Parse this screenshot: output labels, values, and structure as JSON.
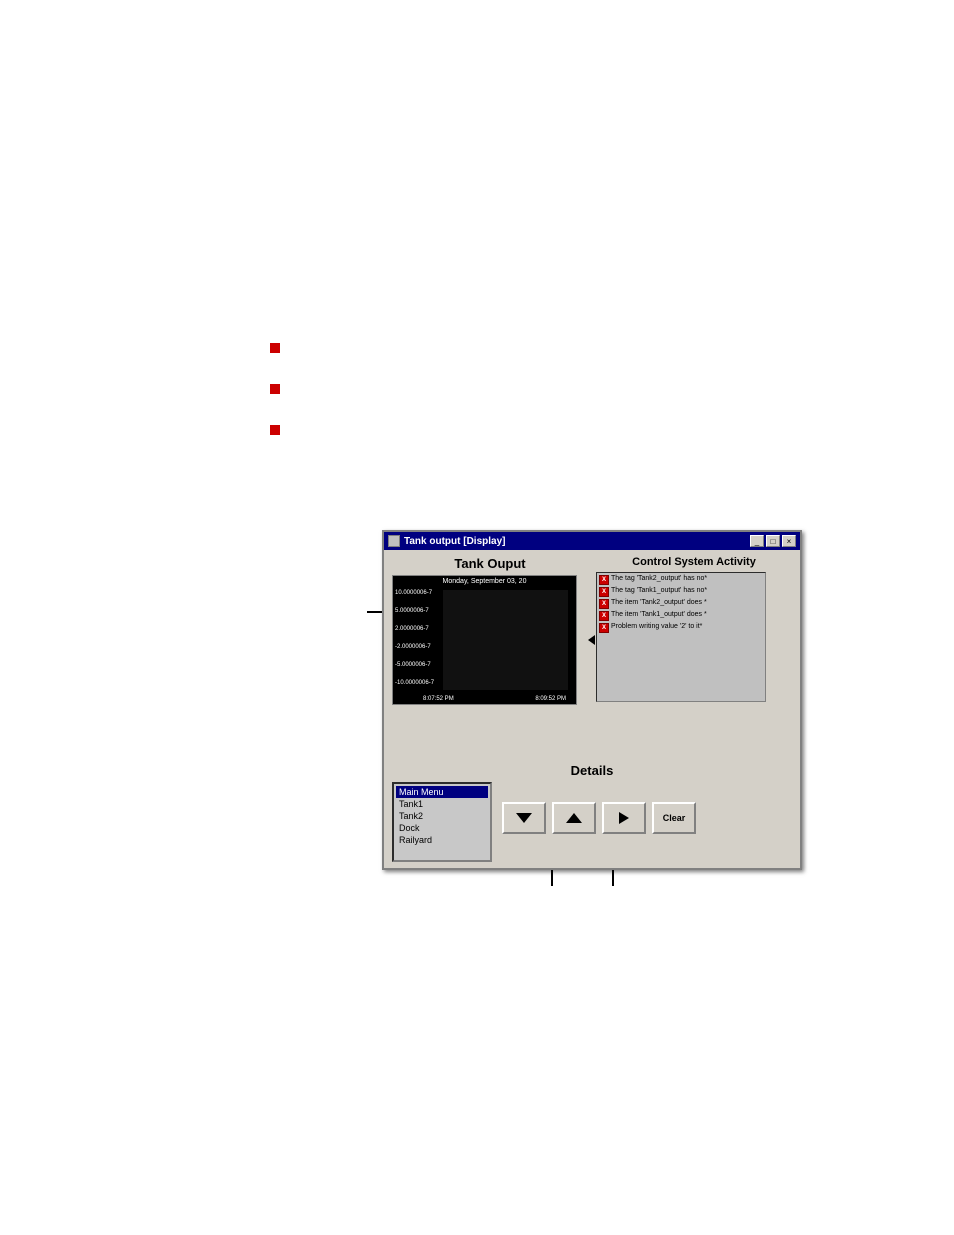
{
  "bullets": [
    {
      "id": "bullet-1"
    },
    {
      "id": "bullet-2"
    },
    {
      "id": "bullet-3"
    }
  ],
  "window": {
    "title": "Tank output [Display]",
    "controls": {
      "minimize": "_",
      "maximize": "□",
      "close": "×"
    }
  },
  "tank_output": {
    "section_title": "Tank Ouput",
    "chart": {
      "date": "Monday, September 03, 20",
      "y_labels": [
        "10.0000006-7",
        "5.0000006-7",
        "2.0000006-7",
        "-2.0000006-7",
        "-5.0000006-7",
        "-10.0000006-7"
      ],
      "x_labels": [
        "8:07:52 PM",
        "8:09:52 PM"
      ]
    }
  },
  "control_system": {
    "section_title": "Control System Activity",
    "items": [
      {
        "icon": "X",
        "text": "The tag 'Tank2_output' has no*"
      },
      {
        "icon": "X",
        "text": "The tag 'Tank1_output' has no*"
      },
      {
        "icon": "X",
        "text": "The item 'Tank2_output' does *"
      },
      {
        "icon": "X",
        "text": "The item 'Tank1_output' does *"
      },
      {
        "icon": "X",
        "text": "Problem writing value '2' to it*"
      }
    ]
  },
  "details": {
    "section_title": "Details",
    "menu_items": [
      {
        "label": "Main Menu",
        "selected": true
      },
      {
        "label": "Tank1",
        "selected": false
      },
      {
        "label": "Tank2",
        "selected": false
      },
      {
        "label": "Dock",
        "selected": false
      },
      {
        "label": "Railyard",
        "selected": false
      }
    ],
    "buttons": {
      "down": "▼",
      "up": "▲",
      "enter": "↵",
      "clear": "Clear"
    }
  }
}
